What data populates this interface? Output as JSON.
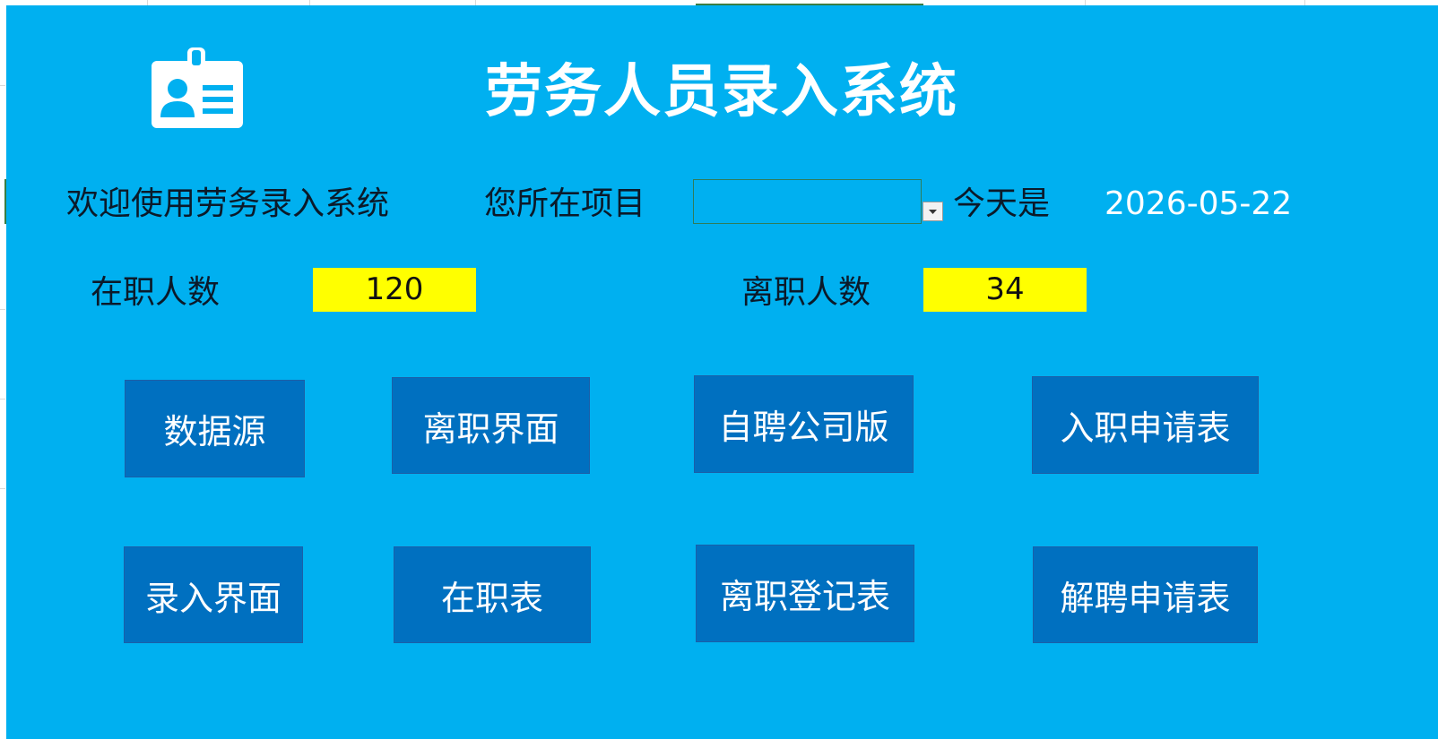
{
  "app": {
    "title": "劳务人员录入系统"
  },
  "header": {
    "welcome_text": "欢迎使用劳务录入系统",
    "project_label": "您所在项目",
    "project_value": "",
    "today_label": "今天是",
    "today_value": "2026-05-22"
  },
  "stats": {
    "active_label": "在职人数",
    "active_count": "120",
    "resigned_label": "离职人数",
    "resigned_count": "34"
  },
  "buttons": {
    "data_source": "数据源",
    "resign_ui": "离职界面",
    "self_hire_company": "自聘公司版",
    "onboard_application": "入职申请表",
    "entry_ui": "录入界面",
    "active_sheet": "在职表",
    "resign_register": "离职登记表",
    "dismissal_application": "解聘申请表"
  },
  "colors": {
    "panel_background": "#00b0f0",
    "button_background": "#0070c0",
    "highlight_yellow": "#ffff00",
    "text_white": "#ffffff"
  },
  "icons": {
    "badge": "id-badge-icon",
    "dropdown": "chevron-down-icon"
  }
}
